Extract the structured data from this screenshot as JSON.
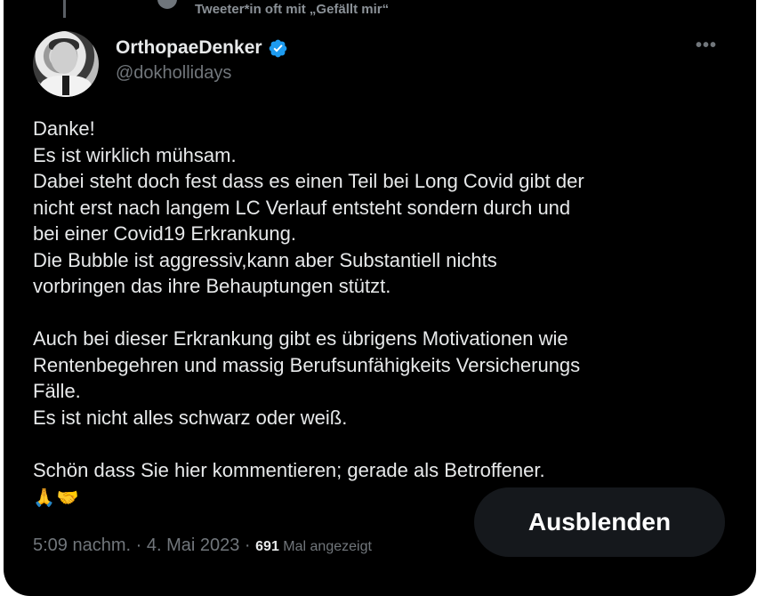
{
  "context": {
    "text": "Tweeter*in oft mit „Gefällt mir“"
  },
  "author": {
    "name": "OrthopaeDenker",
    "handle": "@dokhollidays"
  },
  "tweet": {
    "lines": [
      "Danke!",
      "Es ist wirklich mühsam.",
      "Dabei steht doch fest dass es einen Teil bei Long Covid gibt der",
      "nicht erst nach langem LC Verlauf entsteht sondern durch und",
      "bei einer Covid19 Erkrankung.",
      "Die Bubble ist aggressiv,kann aber Substantiell nichts",
      "vorbringen das ihre Behauptungen stützt.",
      "",
      "Auch bei dieser Erkrankung gibt es übrigens Motivationen wie",
      "Rentenbegehren und massig Berufsunfähigkeits Versicherungs",
      "Fälle.",
      "Es ist nicht alles schwarz oder weiß.",
      "",
      "Schön dass Sie hier kommentieren; gerade als Betroffener."
    ],
    "emojis": [
      "🙏",
      "🤝"
    ]
  },
  "meta": {
    "time": "5:09 nachm.",
    "sep1": " · ",
    "date": "4. Mai 2023",
    "sep2": " · ",
    "views": "691",
    "views_label": " Mal angezeigt"
  },
  "actions": {
    "hide_label": "Ausblenden"
  },
  "icons": {
    "verified": "verified-badge-icon",
    "more": "more-options-icon",
    "context": "heart-icon"
  },
  "colors": {
    "background": "#000000",
    "text": "#e7e9ea",
    "muted": "#71767b",
    "verified": "#1d9bf0",
    "button_bg": "#15181c"
  }
}
